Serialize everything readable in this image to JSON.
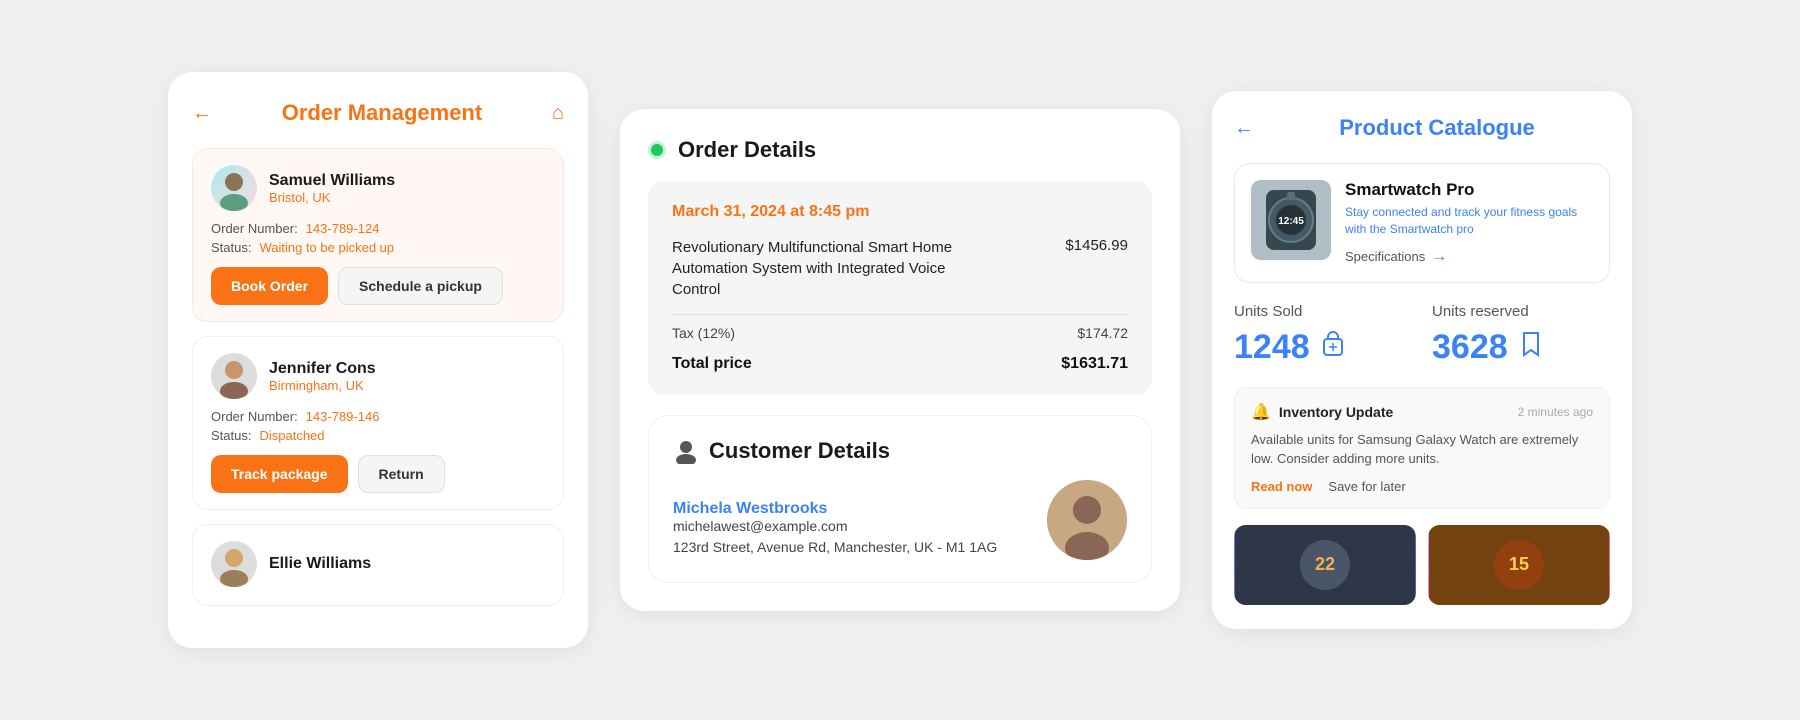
{
  "leftPanel": {
    "title": "Order Management",
    "backIcon": "←",
    "homeIcon": "⌂",
    "orders": [
      {
        "name": "Samuel Williams",
        "location": "Bristol, UK",
        "orderNumber": "143-789-124",
        "status": "Waiting to be picked up",
        "btn1": "Book Order",
        "btn2": "Schedule a pickup",
        "highlighted": true
      },
      {
        "name": "Jennifer Cons",
        "location": "Birmingham, UK",
        "orderNumber": "143-789-146",
        "status": "Dispatched",
        "btn1": "Track package",
        "btn2": "Return",
        "highlighted": false
      },
      {
        "name": "Ellie Williams",
        "location": "",
        "orderNumber": "",
        "status": "",
        "btn1": "",
        "btn2": "",
        "highlighted": false
      }
    ]
  },
  "middlePanel": {
    "orderDetails": {
      "title": "Order Details",
      "date": "March 31, 2024 at 8:45 pm",
      "itemName": "Revolutionary Multifunctional Smart Home Automation System with Integrated Voice Control",
      "itemPrice": "$1456.99",
      "taxLabel": "Tax (12%)",
      "taxValue": "$174.72",
      "totalLabel": "Total price",
      "totalValue": "$1631.71"
    },
    "customerDetails": {
      "title": "Customer Details",
      "customerName": "Michela Westbrooks",
      "email": "michelawest@example.com",
      "address": "123rd Street, Avenue Rd, Manchester, UK - M1 1AG"
    }
  },
  "rightPanel": {
    "title": "Product Catalogue",
    "backIcon": "←",
    "product": {
      "name": "Smartwatch Pro",
      "description": "Stay connected and track your fitness goals with the Smartwatch pro",
      "specsLabel": "Specifications",
      "specsArrow": "→"
    },
    "stats": {
      "soldLabel": "Units Sold",
      "soldValue": "1248",
      "reservedLabel": "Units reserved",
      "reservedValue": "3628"
    },
    "notification": {
      "icon": "🔔",
      "title": "Inventory Update",
      "time": "2 minutes ago",
      "text": "Available units for Samsung Galaxy Watch are extremely low. Consider adding more units.",
      "readNow": "Read now",
      "saveForLater": "Save for later"
    }
  }
}
